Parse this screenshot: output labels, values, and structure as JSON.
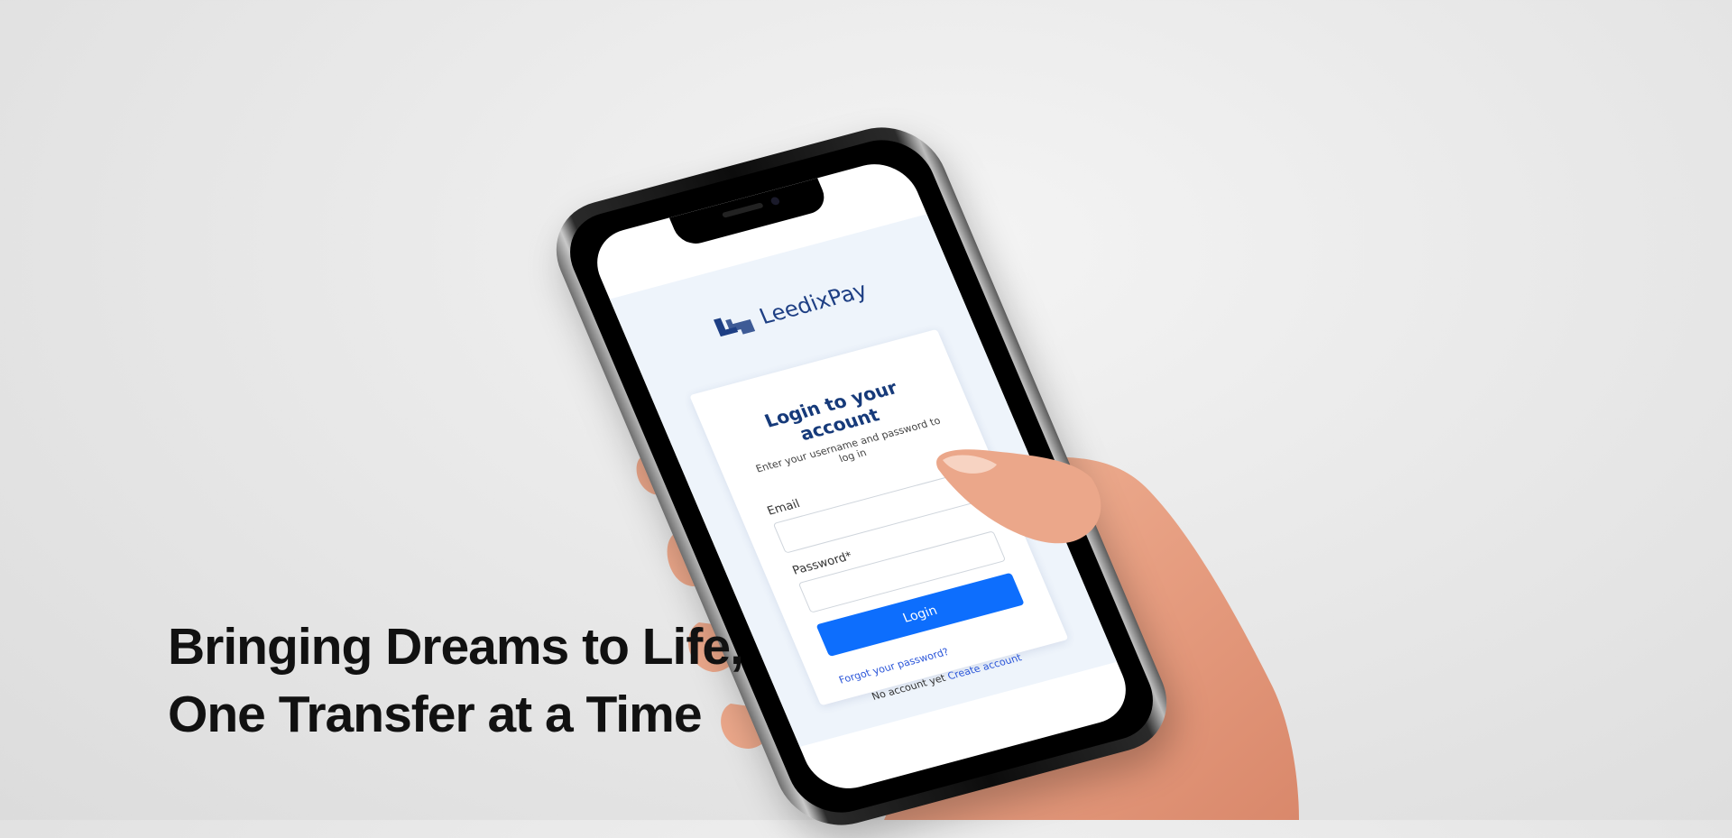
{
  "brand": {
    "name": "LeedixPay"
  },
  "login": {
    "title": "Login to your account",
    "subtitle": "Enter your username and password to log in",
    "email_label": "Email",
    "password_label": "Password*",
    "submit_label": "Login",
    "forgot_link": "Forgot your password?",
    "no_account_text": "No account yet",
    "create_account_link": "Create account"
  },
  "hero": {
    "line1": "Bringing Dreams to Life,",
    "line2": "One Transfer at a Time"
  },
  "colors": {
    "primary": "#0d6efd",
    "brand": "#1e3f84",
    "link": "#2b56d9",
    "screen_bg": "#eef4fb"
  }
}
